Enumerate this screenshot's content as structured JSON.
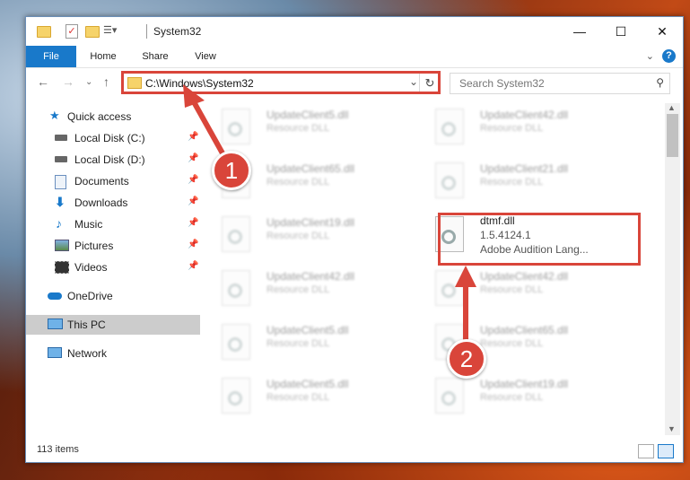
{
  "window": {
    "title": "System32"
  },
  "titlebar": {
    "minimize": "—",
    "maximize": "☐",
    "close": "✕"
  },
  "ribbon": {
    "tabs": [
      "File",
      "Home",
      "Share",
      "View"
    ],
    "help": "?"
  },
  "address": {
    "path": "C:\\Windows\\System32"
  },
  "search": {
    "placeholder": "Search System32"
  },
  "nav": {
    "quick_access": "Quick access",
    "items": [
      {
        "label": "Local Disk (C:)",
        "pinned": true,
        "icon": "drive-icon"
      },
      {
        "label": "Local Disk (D:)",
        "pinned": true,
        "icon": "drive-icon"
      },
      {
        "label": "Documents",
        "pinned": true,
        "icon": "documents-icon"
      },
      {
        "label": "Downloads",
        "pinned": true,
        "icon": "downloads-icon"
      },
      {
        "label": "Music",
        "pinned": true,
        "icon": "music-icon"
      },
      {
        "label": "Pictures",
        "pinned": true,
        "icon": "pictures-icon"
      },
      {
        "label": "Videos",
        "pinned": true,
        "icon": "videos-icon"
      }
    ],
    "onedrive": "OneDrive",
    "this_pc": "This PC",
    "network": "Network"
  },
  "files": {
    "left": [
      {
        "name": "UpdateClient5.dll",
        "desc": "Resource DLL"
      },
      {
        "name": "UpdateClient65.dll",
        "desc": "Resource DLL"
      },
      {
        "name": "UpdateClient19.dll",
        "desc": "Resource DLL"
      },
      {
        "name": "UpdateClient42.dll",
        "desc": "Resource DLL"
      },
      {
        "name": "UpdateClient5.dll",
        "desc": "Resource DLL"
      },
      {
        "name": "UpdateClient5.dll",
        "desc": "Resource DLL"
      }
    ],
    "right": [
      {
        "name": "UpdateClient42.dll",
        "desc": "Resource DLL"
      },
      {
        "name": "UpdateClient21.dll",
        "desc": "Resource DLL"
      },
      {
        "name": "dtmf.dll",
        "version": "1.5.4124.1",
        "desc": "Adobe Audition Lang..."
      },
      {
        "name": "UpdateClient42.dll",
        "desc": "Resource DLL"
      },
      {
        "name": "UpdateClient65.dll",
        "desc": "Resource DLL"
      },
      {
        "name": "UpdateClient19.dll",
        "desc": "Resource DLL"
      }
    ]
  },
  "status": {
    "count": "113 items"
  },
  "callouts": {
    "one": "1",
    "two": "2"
  },
  "colors": {
    "accent": "#1979ca",
    "callout": "#d9453a"
  }
}
